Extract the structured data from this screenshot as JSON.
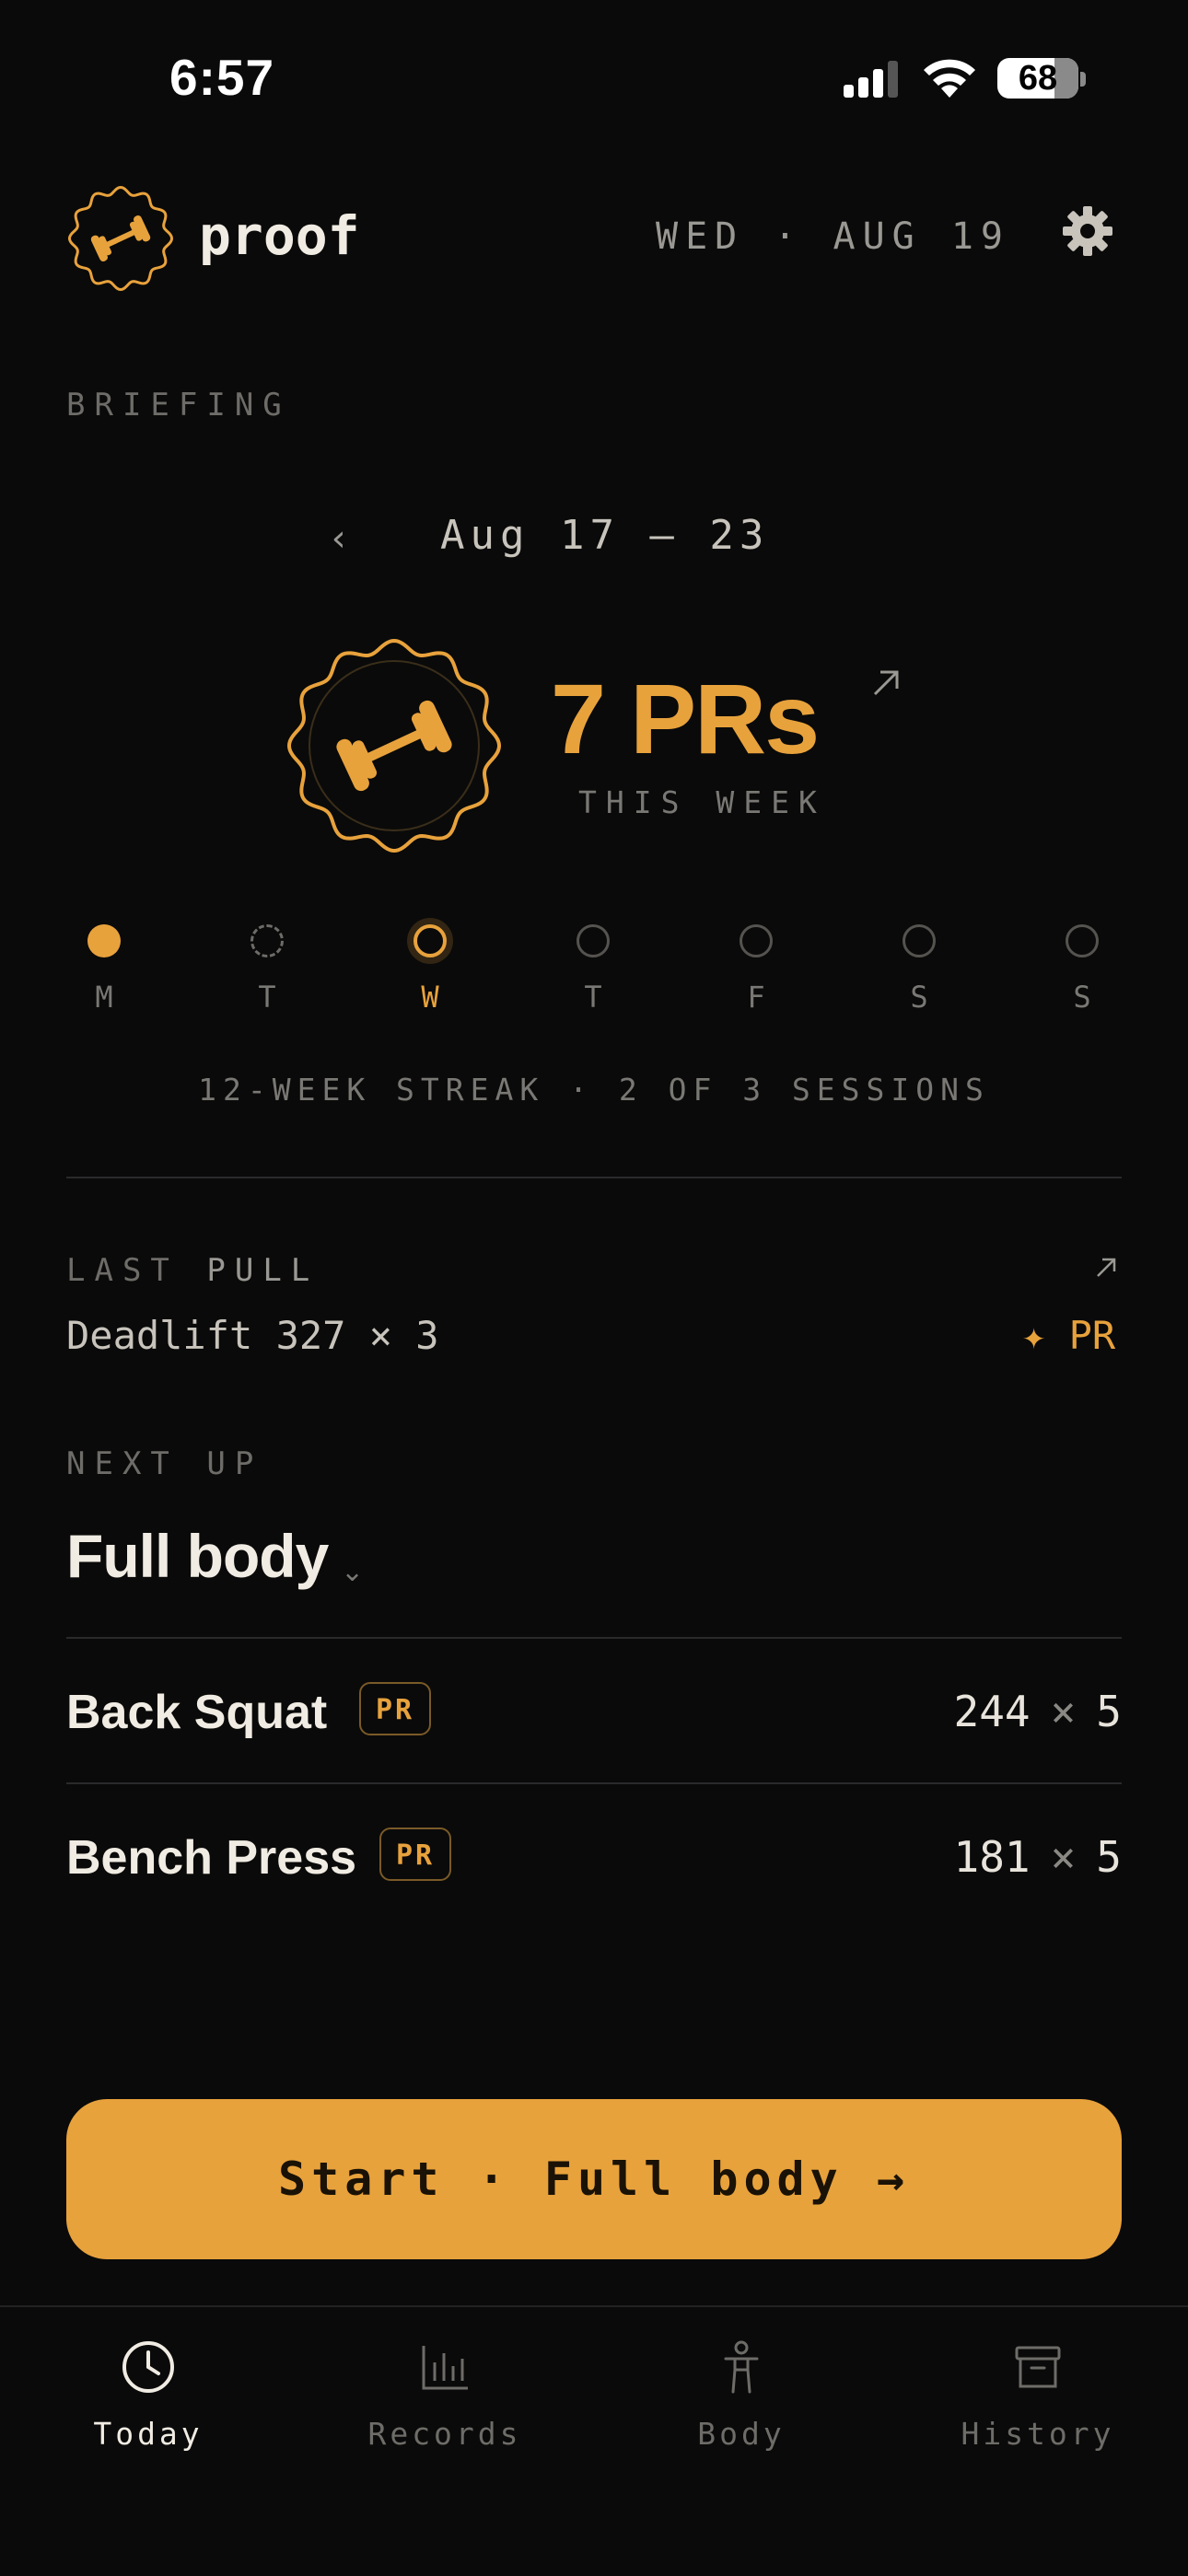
{
  "status_bar": {
    "time": "6:57",
    "battery": "68"
  },
  "header": {
    "app_name": "proof",
    "date": "WED · AUG 19"
  },
  "briefing": {
    "section_label": "BRIEFING",
    "week_range": "Aug 17 – 23",
    "pr_count": "7 PRs",
    "pr_caption": "THIS WEEK",
    "days": [
      {
        "label": "M",
        "state": "done"
      },
      {
        "label": "T",
        "state": "partial"
      },
      {
        "label": "W",
        "state": "today"
      },
      {
        "label": "T",
        "state": "future"
      },
      {
        "label": "F",
        "state": "future"
      },
      {
        "label": "S",
        "state": "future"
      },
      {
        "label": "S",
        "state": "future"
      }
    ],
    "streak": "12-WEEK STREAK · 2 OF 3 SESSIONS"
  },
  "last": {
    "label_prefix": "LAST",
    "label_category": "PULL",
    "value": "Deadlift 327 × 3",
    "pr_text": "✦ PR"
  },
  "next": {
    "label": "NEXT UP",
    "title": "Full body",
    "exercises": [
      {
        "name": "Back Squat",
        "tag": "PR",
        "weight": "244",
        "times": "×",
        "reps": "5"
      },
      {
        "name": "Bench Press",
        "tag": "PR",
        "weight": "181",
        "times": "×",
        "reps": "5"
      }
    ]
  },
  "cta": {
    "label": "Start · Full body →"
  },
  "tabs": [
    {
      "label": "Today",
      "icon": "clock-icon",
      "active": true
    },
    {
      "label": "Records",
      "icon": "bar-chart-icon",
      "active": false
    },
    {
      "label": "Body",
      "icon": "person-icon",
      "active": false
    },
    {
      "label": "History",
      "icon": "archive-icon",
      "active": false
    }
  ],
  "colors": {
    "accent": "#e8a23c",
    "background": "#0a0a0a",
    "text": "#f1ece3",
    "muted": "#7a7874"
  }
}
